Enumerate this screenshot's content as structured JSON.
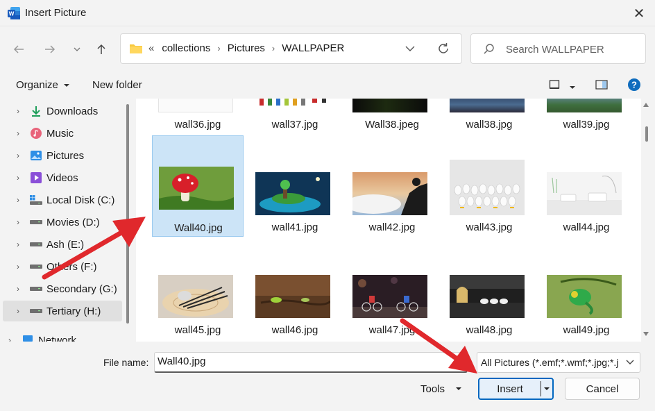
{
  "window": {
    "title": "Insert Picture",
    "close_glyph": "✕",
    "app_icon": "word-icon"
  },
  "nav": {
    "back_icon": "arrow-left-icon",
    "forward_icon": "arrow-right-icon",
    "recent_icon": "chevron-down-icon",
    "up_icon": "arrow-up-icon",
    "address": {
      "overflow": "«",
      "crumbs": [
        "collections",
        "Pictures",
        "WALLPAPER"
      ],
      "separator": "›"
    },
    "search_placeholder": "Search WALLPAPER"
  },
  "toolbar": {
    "organize": "Organize",
    "new_folder": "New folder"
  },
  "sidebar": {
    "items": [
      {
        "label": "Downloads",
        "icon": "download-icon"
      },
      {
        "label": "Music",
        "icon": "music-icon"
      },
      {
        "label": "Pictures",
        "icon": "pictures-icon"
      },
      {
        "label": "Videos",
        "icon": "videos-icon"
      },
      {
        "label": "Local Disk (C:)",
        "icon": "windows-drive-icon"
      },
      {
        "label": "Movies (D:)",
        "icon": "drive-icon"
      },
      {
        "label": "Ash (E:)",
        "icon": "drive-icon"
      },
      {
        "label": "Others (F:)",
        "icon": "drive-icon"
      },
      {
        "label": "Secondary (G:)",
        "icon": "drive-icon"
      },
      {
        "label": "Tertiary (H:)",
        "icon": "drive-icon",
        "selected": true
      },
      {
        "label": "Network",
        "icon": "network-icon"
      }
    ]
  },
  "files": {
    "row1": [
      "wall36.jpg",
      "wall37.jpg",
      "Wall38.jpeg",
      "wall38.jpg",
      "wall39.jpg"
    ],
    "row2": [
      "Wall40.jpg",
      "wall41.jpg",
      "wall42.jpg",
      "wall43.jpg",
      "wall44.jpg"
    ],
    "row3": [
      "wall45.jpg",
      "wall46.jpg",
      "wall47.jpg",
      "wall48.jpg",
      "wall49.jpg"
    ],
    "selected": "Wall40.jpg"
  },
  "bottom": {
    "file_name_label": "File name:",
    "file_name_value": "Wall40.jpg",
    "filter": "All Pictures (*.emf;*.wmf;*.jpg;*.j",
    "tools": "Tools",
    "insert": "Insert",
    "cancel": "Cancel"
  },
  "colors": {
    "accent": "#0067c0",
    "selection": "#cce4f7",
    "annotation_arrow": "#e0282c"
  }
}
